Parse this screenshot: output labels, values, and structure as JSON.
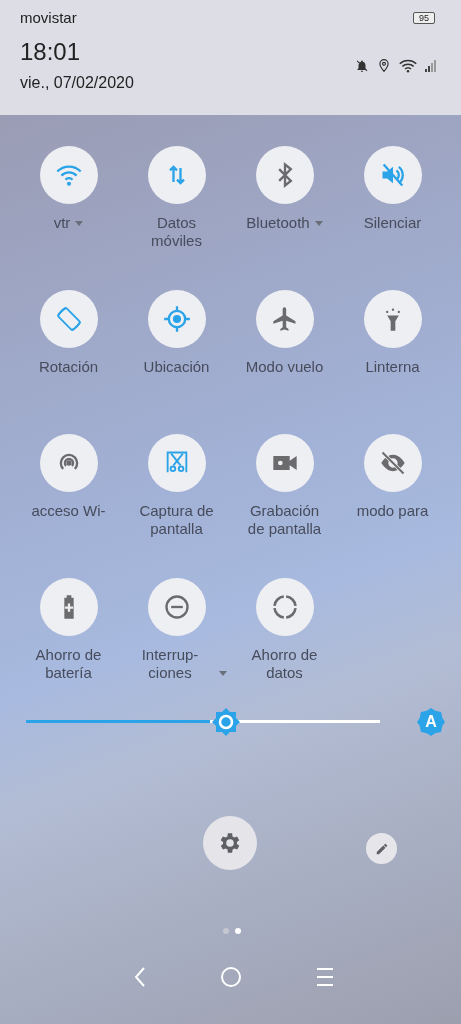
{
  "status_bar": {
    "carrier": "movistar",
    "battery": "95",
    "time": "18:01",
    "date": "vie., 07/02/2020"
  },
  "tiles": [
    {
      "label": "vtr",
      "on": true,
      "dropdown": true
    },
    {
      "label": "Datos móviles",
      "on": true,
      "dropdown": false
    },
    {
      "label": "Bluetooth",
      "on": false,
      "dropdown": true
    },
    {
      "label": "Silenciar",
      "on": true,
      "dropdown": false
    },
    {
      "label": "Rotación",
      "on": true,
      "dropdown": false
    },
    {
      "label": "Ubicación",
      "on": true,
      "dropdown": false
    },
    {
      "label": "Modo vuelo",
      "on": false,
      "dropdown": false
    },
    {
      "label": "Linterna",
      "on": false,
      "dropdown": false
    },
    {
      "label": "acceso Wi-",
      "on": false,
      "dropdown": false
    },
    {
      "label": "Captura de pantalla",
      "on": true,
      "dropdown": false
    },
    {
      "label": "Grabación de pantalla",
      "on": false,
      "dropdown": false
    },
    {
      "label": "modo para",
      "on": false,
      "dropdown": false
    },
    {
      "label": "Ahorro de batería",
      "on": false,
      "dropdown": false
    },
    {
      "label": "Interrup- ciones",
      "on": false,
      "dropdown": true
    },
    {
      "label": "Ahorro de datos",
      "on": false,
      "dropdown": false
    }
  ],
  "brightness": {
    "level": 0.52,
    "auto_label": "A"
  },
  "pages": [
    {
      "selected": false
    },
    {
      "selected": true
    }
  ]
}
